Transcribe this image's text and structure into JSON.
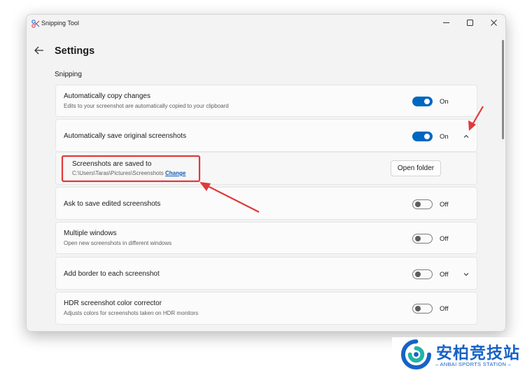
{
  "window": {
    "title": "Snipping Tool"
  },
  "page": {
    "title": "Settings",
    "section": "Snipping"
  },
  "rows": [
    {
      "title": "Automatically copy changes",
      "description": "Edits to your screenshot are automatically copied to your clipboard",
      "state": "On"
    },
    {
      "title": "Automatically save original screenshots",
      "state": "On"
    },
    {
      "title": "Screenshots are saved to",
      "path": "C:\\Users\\Taras\\Pictures\\Screenshots",
      "link": "Change",
      "button": "Open folder"
    },
    {
      "title": "Ask to save edited screenshots",
      "state": "Off"
    },
    {
      "title": "Multiple windows",
      "description": "Open new screenshots in different windows",
      "state": "Off"
    },
    {
      "title": "Add border to each screenshot",
      "state": "Off"
    },
    {
      "title": "HDR screenshot color corrector",
      "description": "Adjusts colors for screenshots taken on HDR monitors",
      "state": "Off"
    }
  ],
  "toggles": [
    true,
    true,
    false,
    false,
    false,
    false
  ],
  "colors": {
    "accent": "#0067c0",
    "annotation": "#e0393b",
    "link": "#0a5bb5"
  },
  "watermark": {
    "name": "安柏竞技站",
    "tagline": "– ANBAI SPORTS STATION –"
  }
}
